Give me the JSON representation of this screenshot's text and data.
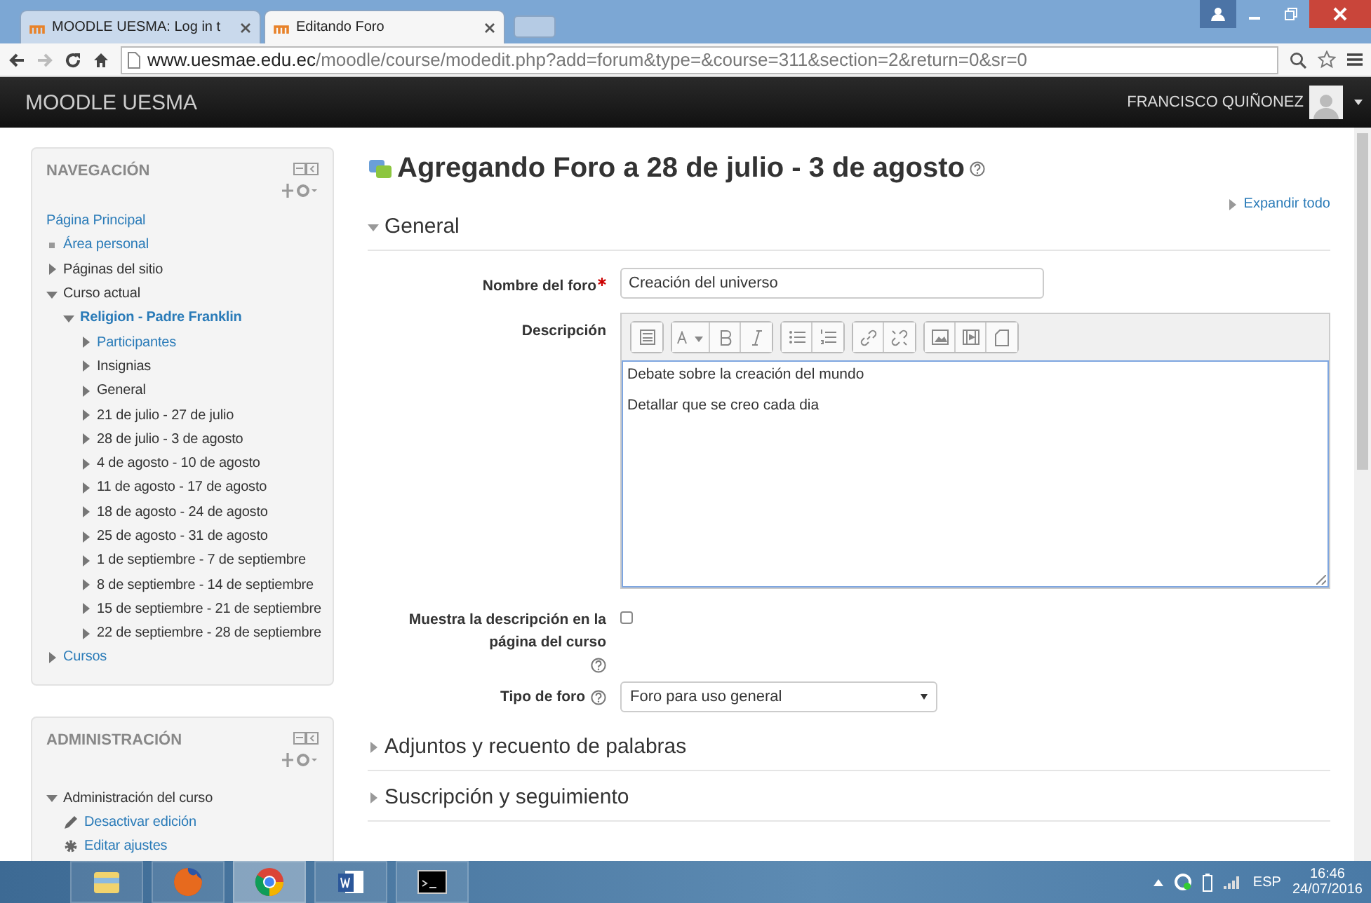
{
  "browser": {
    "tabs": [
      {
        "title": "MOODLE UESMA: Log in t",
        "selected": false
      },
      {
        "title": "Editando Foro",
        "selected": true
      }
    ],
    "url_host": "www.uesmae.edu.ec",
    "url_path": "/moodle/course/modedit.php?add=forum&type=&course=311&section=2&return=0&sr=0"
  },
  "header": {
    "site_name": "MOODLE UESMA",
    "user_name": "FRANCISCO QUIÑONEZ"
  },
  "navigation": {
    "title": "NAVEGACIÓN",
    "items": [
      {
        "label": "Página Principal",
        "kind": "home",
        "link": true
      },
      {
        "label": "Área personal",
        "kind": "leaf",
        "link": true
      },
      {
        "label": "Páginas del sitio",
        "kind": "branch",
        "link": false,
        "expanded": false
      },
      {
        "label": "Curso actual",
        "kind": "branch",
        "link": false,
        "expanded": true,
        "children": [
          {
            "label": "Religion - Padre Franklin",
            "kind": "course",
            "link": true,
            "expanded": true,
            "children": [
              {
                "label": "Participantes",
                "kind": "branch",
                "link": true,
                "expanded": false
              },
              {
                "label": "Insignias",
                "kind": "branch",
                "link": false,
                "expanded": false
              },
              {
                "label": "General",
                "kind": "branch",
                "link": false,
                "expanded": false
              },
              {
                "label": "21 de julio - 27 de julio",
                "kind": "branch",
                "link": false,
                "expanded": false
              },
              {
                "label": "28 de julio - 3 de agosto",
                "kind": "branch",
                "link": false,
                "expanded": false
              },
              {
                "label": "4 de agosto - 10 de agosto",
                "kind": "branch",
                "link": false,
                "expanded": false
              },
              {
                "label": "11 de agosto - 17 de agosto",
                "kind": "branch",
                "link": false,
                "expanded": false
              },
              {
                "label": "18 de agosto - 24 de agosto",
                "kind": "branch",
                "link": false,
                "expanded": false
              },
              {
                "label": "25 de agosto - 31 de agosto",
                "kind": "branch",
                "link": false,
                "expanded": false
              },
              {
                "label": "1 de septiembre - 7 de septiembre",
                "kind": "branch",
                "link": false,
                "expanded": false
              },
              {
                "label": "8 de septiembre - 14 de septiembre",
                "kind": "branch",
                "link": false,
                "expanded": false
              },
              {
                "label": "15 de septiembre - 21 de septiembre",
                "kind": "branch",
                "link": false,
                "expanded": false
              },
              {
                "label": "22 de septiembre - 28 de septiembre",
                "kind": "branch",
                "link": false,
                "expanded": false
              }
            ]
          }
        ]
      },
      {
        "label": "Cursos",
        "kind": "branch",
        "link": true,
        "expanded": false
      }
    ]
  },
  "administration": {
    "title": "ADMINISTRACIÓN",
    "items": [
      {
        "label": "Administración del curso",
        "kind": "branch",
        "link": false,
        "expanded": true,
        "children": [
          {
            "label": "Desactivar edición",
            "kind": "edit",
            "link": true
          },
          {
            "label": "Editar ajustes",
            "kind": "settings",
            "link": true
          }
        ]
      }
    ]
  },
  "page": {
    "title": "Agregando Foro a 28 de julio - 3 de agosto",
    "expand_all": "Expandir todo",
    "sections": [
      {
        "title": "General",
        "expanded": true
      },
      {
        "title": "Adjuntos y recuento de palabras",
        "expanded": false
      },
      {
        "title": "Suscripción y seguimiento",
        "expanded": false
      }
    ],
    "forum_name": {
      "label": "Nombre del foro",
      "required": true,
      "value": "Creación del universo"
    },
    "description": {
      "label": "Descripción",
      "paragraphs": [
        "Debate sobre la creación del mundo",
        "Detallar que se creo cada dia"
      ]
    },
    "show_description": {
      "label": "Muestra la descripción en la página del curso",
      "checked": false
    },
    "forum_type": {
      "label": "Tipo de foro",
      "value": "Foro para uso general"
    }
  },
  "taskbar": {
    "apps": [
      {
        "kind": "explorer",
        "selected": false
      },
      {
        "kind": "firefox",
        "selected": false
      },
      {
        "kind": "chrome",
        "selected": true
      },
      {
        "kind": "word",
        "selected": false
      },
      {
        "kind": "terminal",
        "selected": false
      }
    ],
    "language": "ESP",
    "time": "16:46",
    "date": "24/07/2016"
  }
}
